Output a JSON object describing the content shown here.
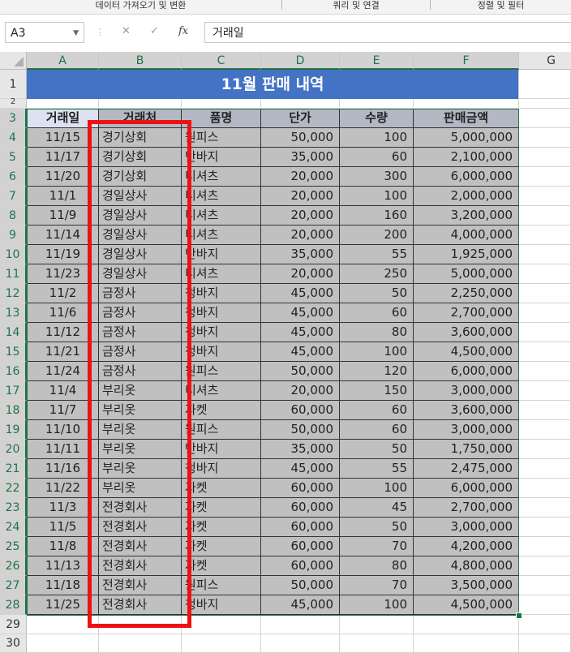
{
  "ribbon": {
    "groups": [
      "데이터 가져오기 및 변환",
      "쿼리 및 연결",
      "정렬 및 필터"
    ]
  },
  "formula_bar": {
    "name_box": "A3",
    "cancel_icon": "✕",
    "enter_icon": "✓",
    "fx_label": "fx",
    "formula": "거래일"
  },
  "columns": [
    "A",
    "B",
    "C",
    "D",
    "E",
    "F",
    "G"
  ],
  "row_numbers": [
    "1",
    "2",
    "3",
    "4",
    "5",
    "6",
    "7",
    "8",
    "9",
    "10",
    "11",
    "12",
    "13",
    "14",
    "15",
    "16",
    "17",
    "18",
    "19",
    "20",
    "21",
    "22",
    "23",
    "24",
    "25",
    "26",
    "27",
    "28",
    "29",
    "30"
  ],
  "sheet": {
    "title": "11월 판매 내역",
    "headers": [
      "거래일",
      "거래처",
      "품명",
      "단가",
      "수량",
      "판매금액"
    ],
    "rows": [
      [
        "11/15",
        "경기상회",
        "원피스",
        "50,000",
        "100",
        "5,000,000"
      ],
      [
        "11/17",
        "경기상회",
        "반바지",
        "35,000",
        "60",
        "2,100,000"
      ],
      [
        "11/20",
        "경기상회",
        "티셔츠",
        "20,000",
        "300",
        "6,000,000"
      ],
      [
        "11/1",
        "경일상사",
        "티셔츠",
        "20,000",
        "100",
        "2,000,000"
      ],
      [
        "11/9",
        "경일상사",
        "티셔츠",
        "20,000",
        "160",
        "3,200,000"
      ],
      [
        "11/14",
        "경일상사",
        "티셔츠",
        "20,000",
        "200",
        "4,000,000"
      ],
      [
        "11/19",
        "경일상사",
        "반바지",
        "35,000",
        "55",
        "1,925,000"
      ],
      [
        "11/23",
        "경일상사",
        "티셔츠",
        "20,000",
        "250",
        "5,000,000"
      ],
      [
        "11/2",
        "금정사",
        "청바지",
        "45,000",
        "50",
        "2,250,000"
      ],
      [
        "11/6",
        "금정사",
        "청바지",
        "45,000",
        "60",
        "2,700,000"
      ],
      [
        "11/12",
        "금정사",
        "청바지",
        "45,000",
        "80",
        "3,600,000"
      ],
      [
        "11/21",
        "금정사",
        "청바지",
        "45,000",
        "100",
        "4,500,000"
      ],
      [
        "11/24",
        "금정사",
        "원피스",
        "50,000",
        "120",
        "6,000,000"
      ],
      [
        "11/4",
        "부리옷",
        "티셔츠",
        "20,000",
        "150",
        "3,000,000"
      ],
      [
        "11/7",
        "부리옷",
        "자켓",
        "60,000",
        "60",
        "3,600,000"
      ],
      [
        "11/10",
        "부리옷",
        "원피스",
        "50,000",
        "60",
        "3,000,000"
      ],
      [
        "11/11",
        "부리옷",
        "반바지",
        "35,000",
        "50",
        "1,750,000"
      ],
      [
        "11/16",
        "부리옷",
        "청바지",
        "45,000",
        "55",
        "2,475,000"
      ],
      [
        "11/22",
        "부리옷",
        "자켓",
        "60,000",
        "100",
        "6,000,000"
      ],
      [
        "11/3",
        "전경회사",
        "자켓",
        "60,000",
        "45",
        "2,700,000"
      ],
      [
        "11/5",
        "전경회사",
        "자켓",
        "60,000",
        "50",
        "3,000,000"
      ],
      [
        "11/8",
        "전경회사",
        "자켓",
        "60,000",
        "70",
        "4,200,000"
      ],
      [
        "11/13",
        "전경회사",
        "자켓",
        "60,000",
        "80",
        "4,800,000"
      ],
      [
        "11/18",
        "전경회사",
        "원피스",
        "50,000",
        "70",
        "3,500,000"
      ],
      [
        "11/25",
        "전경회사",
        "청바지",
        "45,000",
        "100",
        "4,500,000"
      ]
    ]
  },
  "colors": {
    "title_fill": "#4472c4",
    "header_fill": "#b4b8c4",
    "data_fill": "#c0c0c0",
    "selection": "#217346",
    "annotation_box": "#ee1111"
  }
}
